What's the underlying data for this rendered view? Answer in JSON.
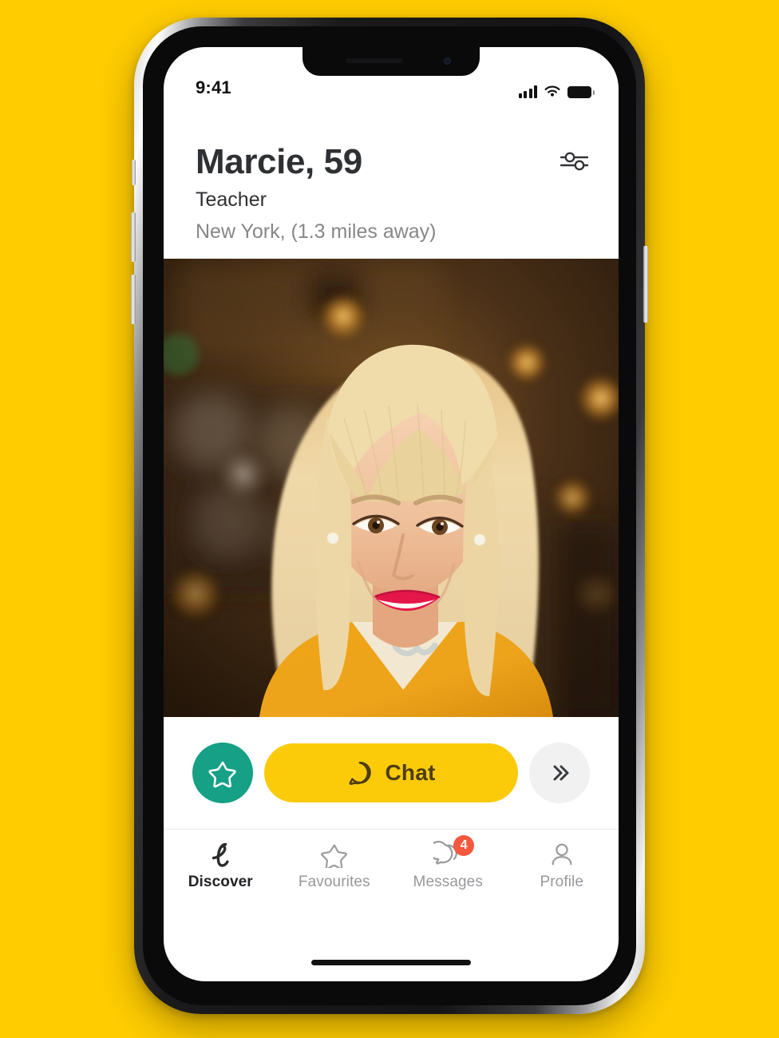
{
  "app": {
    "background_color": "#FFCC00",
    "accent_yellow": "#FBCB0A",
    "accent_teal": "#16A085",
    "badge_color": "#F4593F"
  },
  "status_bar": {
    "time": "9:41",
    "signal_icon": "cellular-signal-icon",
    "wifi_icon": "wifi-icon",
    "battery_icon": "battery-icon"
  },
  "header": {
    "filter_icon": "filter-sliders-icon",
    "filter_label": "Filters"
  },
  "profile": {
    "name": "Marcie, 59",
    "occupation": "Teacher",
    "location": "New York, (1.3 miles away)",
    "photo_alt": "Smiling blonde woman in a yellow jacket"
  },
  "actions": {
    "favourite": {
      "icon": "star-icon",
      "label": "Favourite"
    },
    "chat": {
      "icon": "chat-bubble-icon",
      "label": "Chat"
    },
    "skip": {
      "icon": "double-chevron-right-icon",
      "label": "Skip"
    }
  },
  "tabbar": {
    "items": [
      {
        "id": "discover",
        "label": "Discover",
        "icon": "script-l-logo-icon",
        "active": true,
        "badge": ""
      },
      {
        "id": "favourites",
        "label": "Favourites",
        "icon": "star-icon",
        "active": false,
        "badge": ""
      },
      {
        "id": "messages",
        "label": "Messages",
        "icon": "chat-bubbles-icon",
        "active": false,
        "badge": "4"
      },
      {
        "id": "profile",
        "label": "Profile",
        "icon": "person-icon",
        "active": false,
        "badge": ""
      }
    ]
  },
  "home_indicator": "home-indicator-bar"
}
